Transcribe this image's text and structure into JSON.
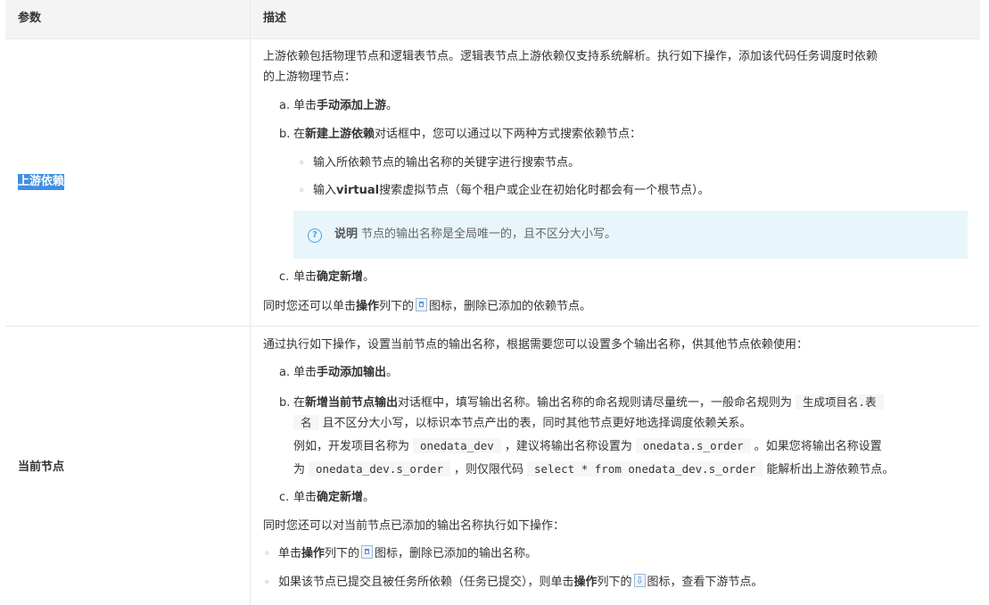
{
  "header": {
    "col1": "参数",
    "col2": "描述"
  },
  "row1": {
    "param": "上游依赖",
    "intro_1": "上游依赖包括物理节点和逻辑表节点。逻辑表节点上游依赖仅支持系统解析。执行如下操作，添加该代码任务调度时依赖",
    "intro_2": "的上游物理节点：",
    "step_a": {
      "mark": "a.",
      "pre": "单击",
      "bold": "手动添加上游",
      "post": "。"
    },
    "step_b": {
      "mark": "b.",
      "pre": "在",
      "bold": "新建上游依赖",
      "post": "对话框中，您可以通过以下两种方式搜索依赖节点："
    },
    "bullet_1": {
      "mark": "◦",
      "text": "输入所依赖节点的输出名称的关键字进行搜索节点。"
    },
    "bullet_2": {
      "mark": "◦",
      "pre": "输入",
      "bold": "virtual",
      "post": "搜索虚拟节点（每个租户或企业在初始化时都会有一个根节点）。"
    },
    "note": {
      "icon": "question-icon",
      "title": "说明",
      "text": "节点的输出名称是全局唯一的，且不区分大小写。"
    },
    "step_c": {
      "mark": "c.",
      "pre": "单击",
      "bold": "确定新增",
      "post": "。"
    },
    "footer": {
      "pre": "同时您还可以单击",
      "bold": "操作",
      "mid": "列下的",
      "post": "图标，删除已添加的依赖节点。",
      "icon": "trash-icon"
    }
  },
  "row2": {
    "param": "当前节点",
    "intro": "通过执行如下操作，设置当前节点的输出名称，根据需要您可以设置多个输出名称，供其他节点依赖使用：",
    "step_a": {
      "mark": "a.",
      "pre": "单击",
      "bold": "手动添加输出",
      "post": "。"
    },
    "step_b": {
      "mark": "b.",
      "pre": "在",
      "bold": "新增当前节点输出",
      "post": "对话框中，填写输出名称。输出名称的命名规则请尽量统一，一般命名规则为",
      "code1a": "生成项目名.表",
      "code1b": "名",
      "line2_post": "且不区分大小写，以标识本节点产出的表，同时其他节点更好地选择调度依赖关系。",
      "line3_pre": "例如，开发项目名称为",
      "code2": "onedata_dev",
      "line3_mid": "，建议将输出名称设置为",
      "code3": "onedata.s_order",
      "line3_post": "。如果您将输出名称设置",
      "line4_pre": "为",
      "code4": "onedata_dev.s_order",
      "line4_mid": "，则仅限代码",
      "code5": "select * from onedata_dev.s_order",
      "line4_post": "能解析出上游依赖节点。"
    },
    "step_c": {
      "mark": "c.",
      "pre": "单击",
      "bold": "确定新增",
      "post": "。"
    },
    "followup": "同时您还可以对当前节点已添加的输出名称执行如下操作：",
    "bullet_1": {
      "mark": "◦",
      "pre": "单击",
      "bold": "操作",
      "mid": "列下的",
      "post": "图标，删除已添加的输出名称。",
      "icon": "trash-icon"
    },
    "bullet_2": {
      "mark": "◦",
      "pre": "如果该节点已提交且被任务所依赖（任务已提交），则单击",
      "bold": "操作",
      "mid": "列下的",
      "post": "图标，查看下游节点。",
      "icon": "download-icon"
    }
  },
  "colors": {
    "header_bg": "#f4f4f4",
    "highlight": "#3e8fe4",
    "note_bg": "#e8f5fb",
    "note_icon": "#4aa3df"
  }
}
